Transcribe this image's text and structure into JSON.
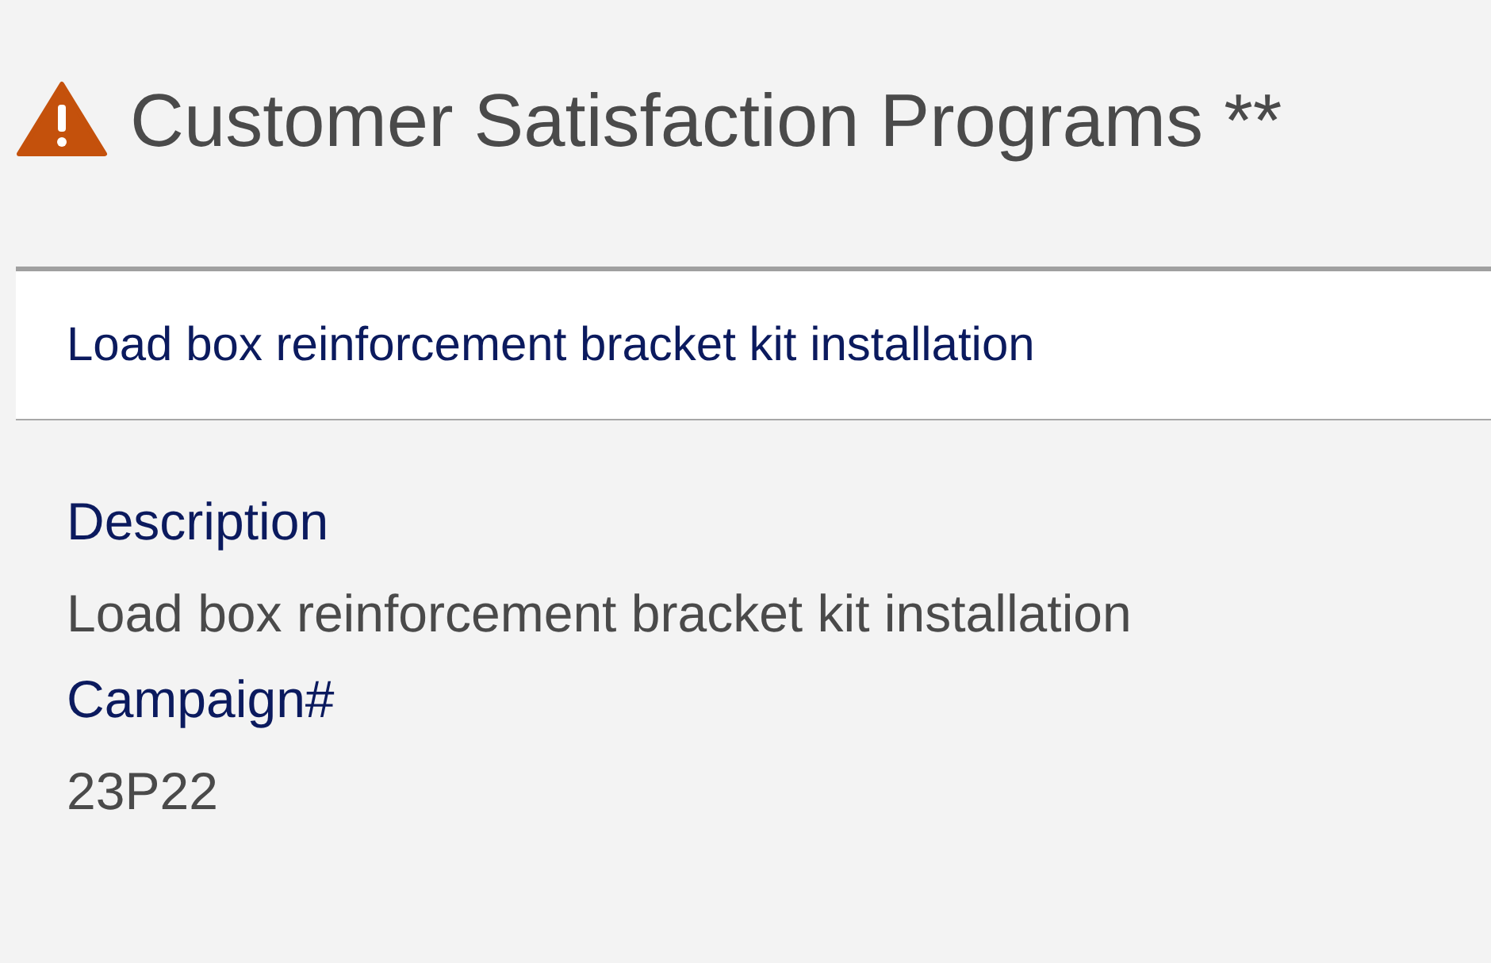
{
  "header": {
    "title": "Customer Satisfaction Programs **",
    "warning": true
  },
  "program": {
    "name": "Load box reinforcement bracket kit installation"
  },
  "fields": [
    {
      "label": "Description",
      "value": "Load box reinforcement bracket kit installation"
    },
    {
      "label": "Campaign#",
      "value": "23P22"
    }
  ]
}
